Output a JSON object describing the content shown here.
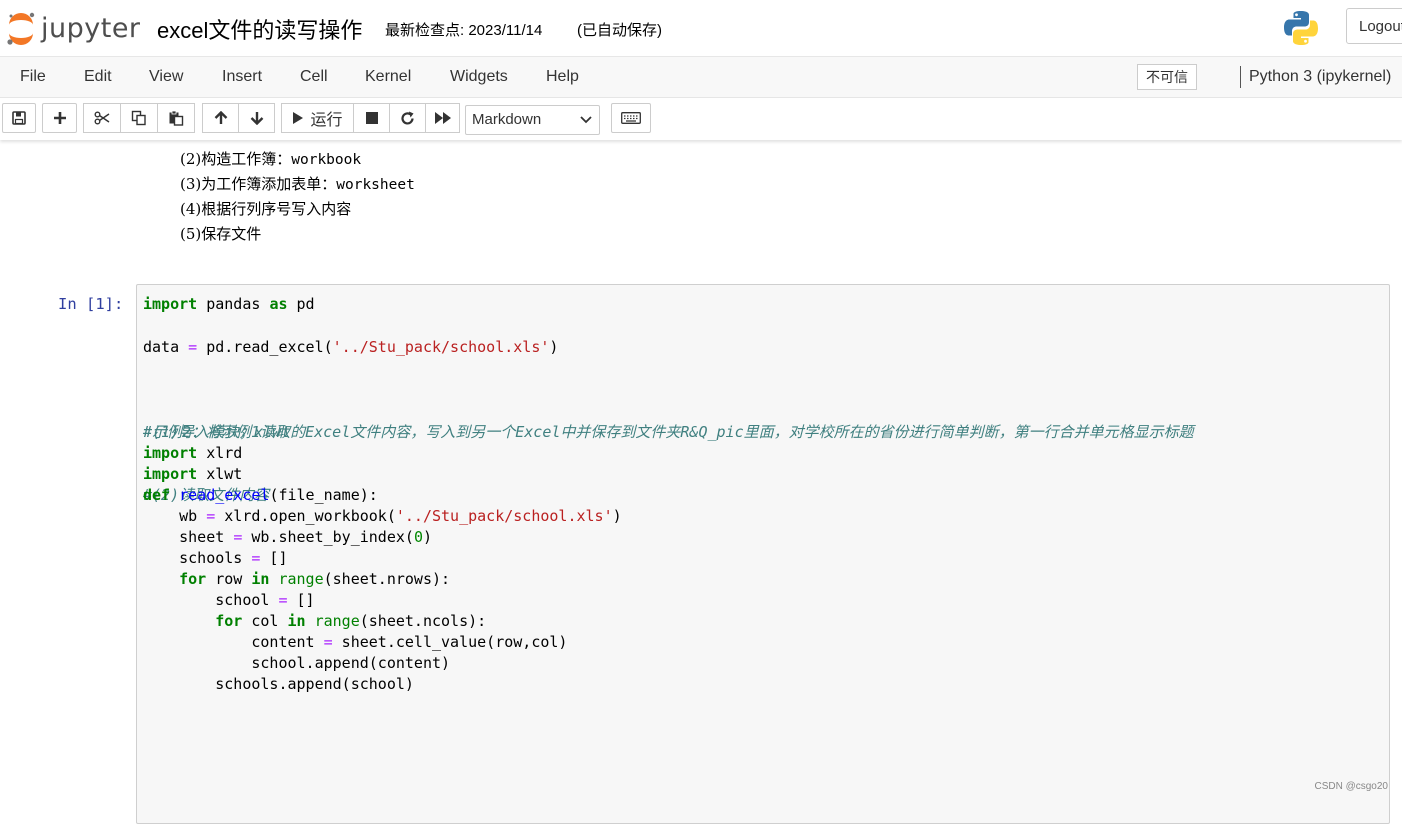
{
  "header": {
    "logo_text": "jupyter",
    "notebook_title": "excel文件的读写操作",
    "checkpoint": "最新检查点: 2023/11/14",
    "autosave": "(已自动保存)",
    "logout_label": "Logout"
  },
  "menubar": {
    "items": [
      "File",
      "Edit",
      "View",
      "Insert",
      "Cell",
      "Kernel",
      "Widgets",
      "Help"
    ],
    "trust_label": "不可信",
    "kernel_name": "Python 3 (ipykernel)"
  },
  "toolbar": {
    "run_label": "运行",
    "cell_type": "Markdown",
    "icons": [
      "save-icon",
      "plus-icon",
      "cut-icon",
      "copy-icon",
      "paste-icon",
      "arrow-up-icon",
      "arrow-down-icon",
      "play-icon",
      "stop-icon",
      "restart-icon",
      "fast-forward-icon",
      "keyboard-icon"
    ]
  },
  "markdown_cell": {
    "lines": [
      {
        "prefix": "(2)构造工作簿：",
        "code": "workbook"
      },
      {
        "prefix": "(3)为工作簿添加表单：",
        "code": "worksheet"
      },
      {
        "prefix": "(4)根据行列序号写入内容",
        "code": ""
      },
      {
        "prefix": "(5)保存文件",
        "code": ""
      }
    ]
  },
  "code_cell": {
    "prompt": "In  [1]:",
    "lines": [
      [
        {
          "t": "import",
          "c": "kw"
        },
        {
          "t": " pandas ",
          "c": ""
        },
        {
          "t": "as",
          "c": "kw"
        },
        {
          "t": " pd",
          "c": ""
        }
      ],
      [],
      [
        {
          "t": "data ",
          "c": ""
        },
        {
          "t": "=",
          "c": "op"
        },
        {
          "t": " pd.read_excel(",
          "c": ""
        },
        {
          "t": "'../Stu_pack/school.xls'",
          "c": "str"
        },
        {
          "t": ")",
          "c": ""
        }
      ],
      [],
      [],
      [],
      [
        {
          "t": "#示例2：将示例1读取的Excel文件内容，写入到另一个Excel中并保存到文件夹R&Q_pic里面，对学校所在的省份进行简单判断，第一行合并单元格显示标题",
          "c": "cm"
        }
      ],
      [],
      [
        {
          "t": "#(1)导入模块；xlwt",
          "c": "cm"
        }
      ],
      [
        {
          "t": "import",
          "c": "kw"
        },
        {
          "t": " xlrd",
          "c": ""
        }
      ],
      [
        {
          "t": "import",
          "c": "kw"
        },
        {
          "t": " xlwt",
          "c": ""
        }
      ],
      [],
      [
        {
          "t": "#(2)读取文件内容",
          "c": "cm"
        }
      ],
      [],
      [
        {
          "t": "def",
          "c": "kw"
        },
        {
          "t": " ",
          "c": ""
        },
        {
          "t": "read_excel",
          "c": "fn"
        },
        {
          "t": "(file_name):",
          "c": ""
        }
      ],
      [
        {
          "t": "    wb ",
          "c": ""
        },
        {
          "t": "=",
          "c": "op"
        },
        {
          "t": " xlrd.open_workbook(",
          "c": ""
        },
        {
          "t": "'../Stu_pack/school.xls'",
          "c": "str"
        },
        {
          "t": ")",
          "c": ""
        }
      ],
      [
        {
          "t": "    sheet ",
          "c": ""
        },
        {
          "t": "=",
          "c": "op"
        },
        {
          "t": " wb.sheet_by_index(",
          "c": ""
        },
        {
          "t": "0",
          "c": "num"
        },
        {
          "t": ")",
          "c": ""
        }
      ],
      [
        {
          "t": "    schools ",
          "c": ""
        },
        {
          "t": "=",
          "c": "op"
        },
        {
          "t": " []",
          "c": ""
        }
      ],
      [
        {
          "t": "    ",
          "c": ""
        },
        {
          "t": "for",
          "c": "kw"
        },
        {
          "t": " row ",
          "c": ""
        },
        {
          "t": "in",
          "c": "kw"
        },
        {
          "t": " ",
          "c": ""
        },
        {
          "t": "range",
          "c": "bi"
        },
        {
          "t": "(sheet.nrows):",
          "c": ""
        }
      ],
      [
        {
          "t": "        school ",
          "c": ""
        },
        {
          "t": "=",
          "c": "op"
        },
        {
          "t": " []",
          "c": ""
        }
      ],
      [
        {
          "t": "        ",
          "c": ""
        },
        {
          "t": "for",
          "c": "kw"
        },
        {
          "t": " col ",
          "c": ""
        },
        {
          "t": "in",
          "c": "kw"
        },
        {
          "t": " ",
          "c": ""
        },
        {
          "t": "range",
          "c": "bi"
        },
        {
          "t": "(sheet.ncols):",
          "c": ""
        }
      ],
      [
        {
          "t": "            content ",
          "c": ""
        },
        {
          "t": "=",
          "c": "op"
        },
        {
          "t": " sheet.cell_value(row,col)",
          "c": ""
        }
      ],
      [
        {
          "t": "            school.append(content)",
          "c": ""
        }
      ],
      [
        {
          "t": "        schools.append(school)",
          "c": ""
        }
      ]
    ]
  },
  "watermark": "CSDN @csgo20"
}
